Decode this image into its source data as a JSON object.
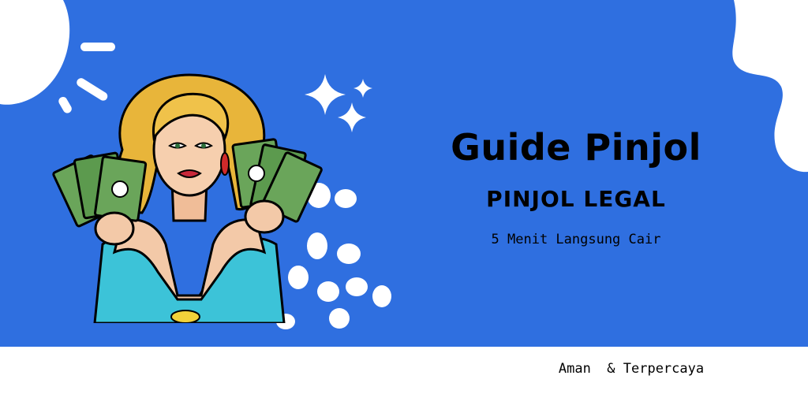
{
  "banner": {
    "title": "Guide Pinjol",
    "subtitle": "PINJOL LEGAL",
    "tagline": "5 Menit Langsung Cair",
    "footer": "Aman  & Terpercaya"
  },
  "colors": {
    "background": "#2f6fe0",
    "footer_bg": "#ffffff",
    "text": "#000000",
    "decor": "#ffffff"
  },
  "icons": [
    "sparkle-icon",
    "money-icon"
  ]
}
